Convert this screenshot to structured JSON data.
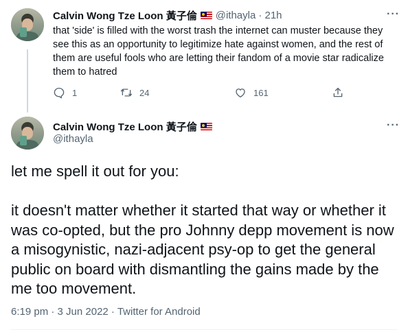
{
  "reply_tweet": {
    "display_name": "Calvin Wong Tze Loon 黃子倫",
    "handle": "@ithayla",
    "time": "· 21h",
    "text": "that 'side' is filled with the worst trash the internet can muster because they see this as an opportunity to legitimize hate against women, and the rest of them are useful fools who are letting their fandom of a movie star radicalize them to hatred",
    "reply_count": "1",
    "retweet_count": "24",
    "like_count": "161",
    "more_label": "···"
  },
  "main_tweet": {
    "display_name": "Calvin Wong Tze Loon 黃子倫",
    "handle": "@ithayla",
    "more_label": "···",
    "text": "let me spell it out for you:\n\nit doesn't matter whether it started that way or whether it was co-opted, but the pro Johnny depp movement is now a misogynistic, nazi-adjacent psy-op to get the general public on board with dismantling the gains made by the me too movement.",
    "timestamp": "6:19 pm · 3 Jun 2022 · Twitter for Android"
  },
  "icons": [
    "reply-icon",
    "retweet-icon",
    "like-icon",
    "share-icon",
    "more-icon",
    "flag-icon"
  ],
  "colors": {
    "text": "#0f1419",
    "secondary": "#536471",
    "thread_line": "#cfd9de"
  }
}
